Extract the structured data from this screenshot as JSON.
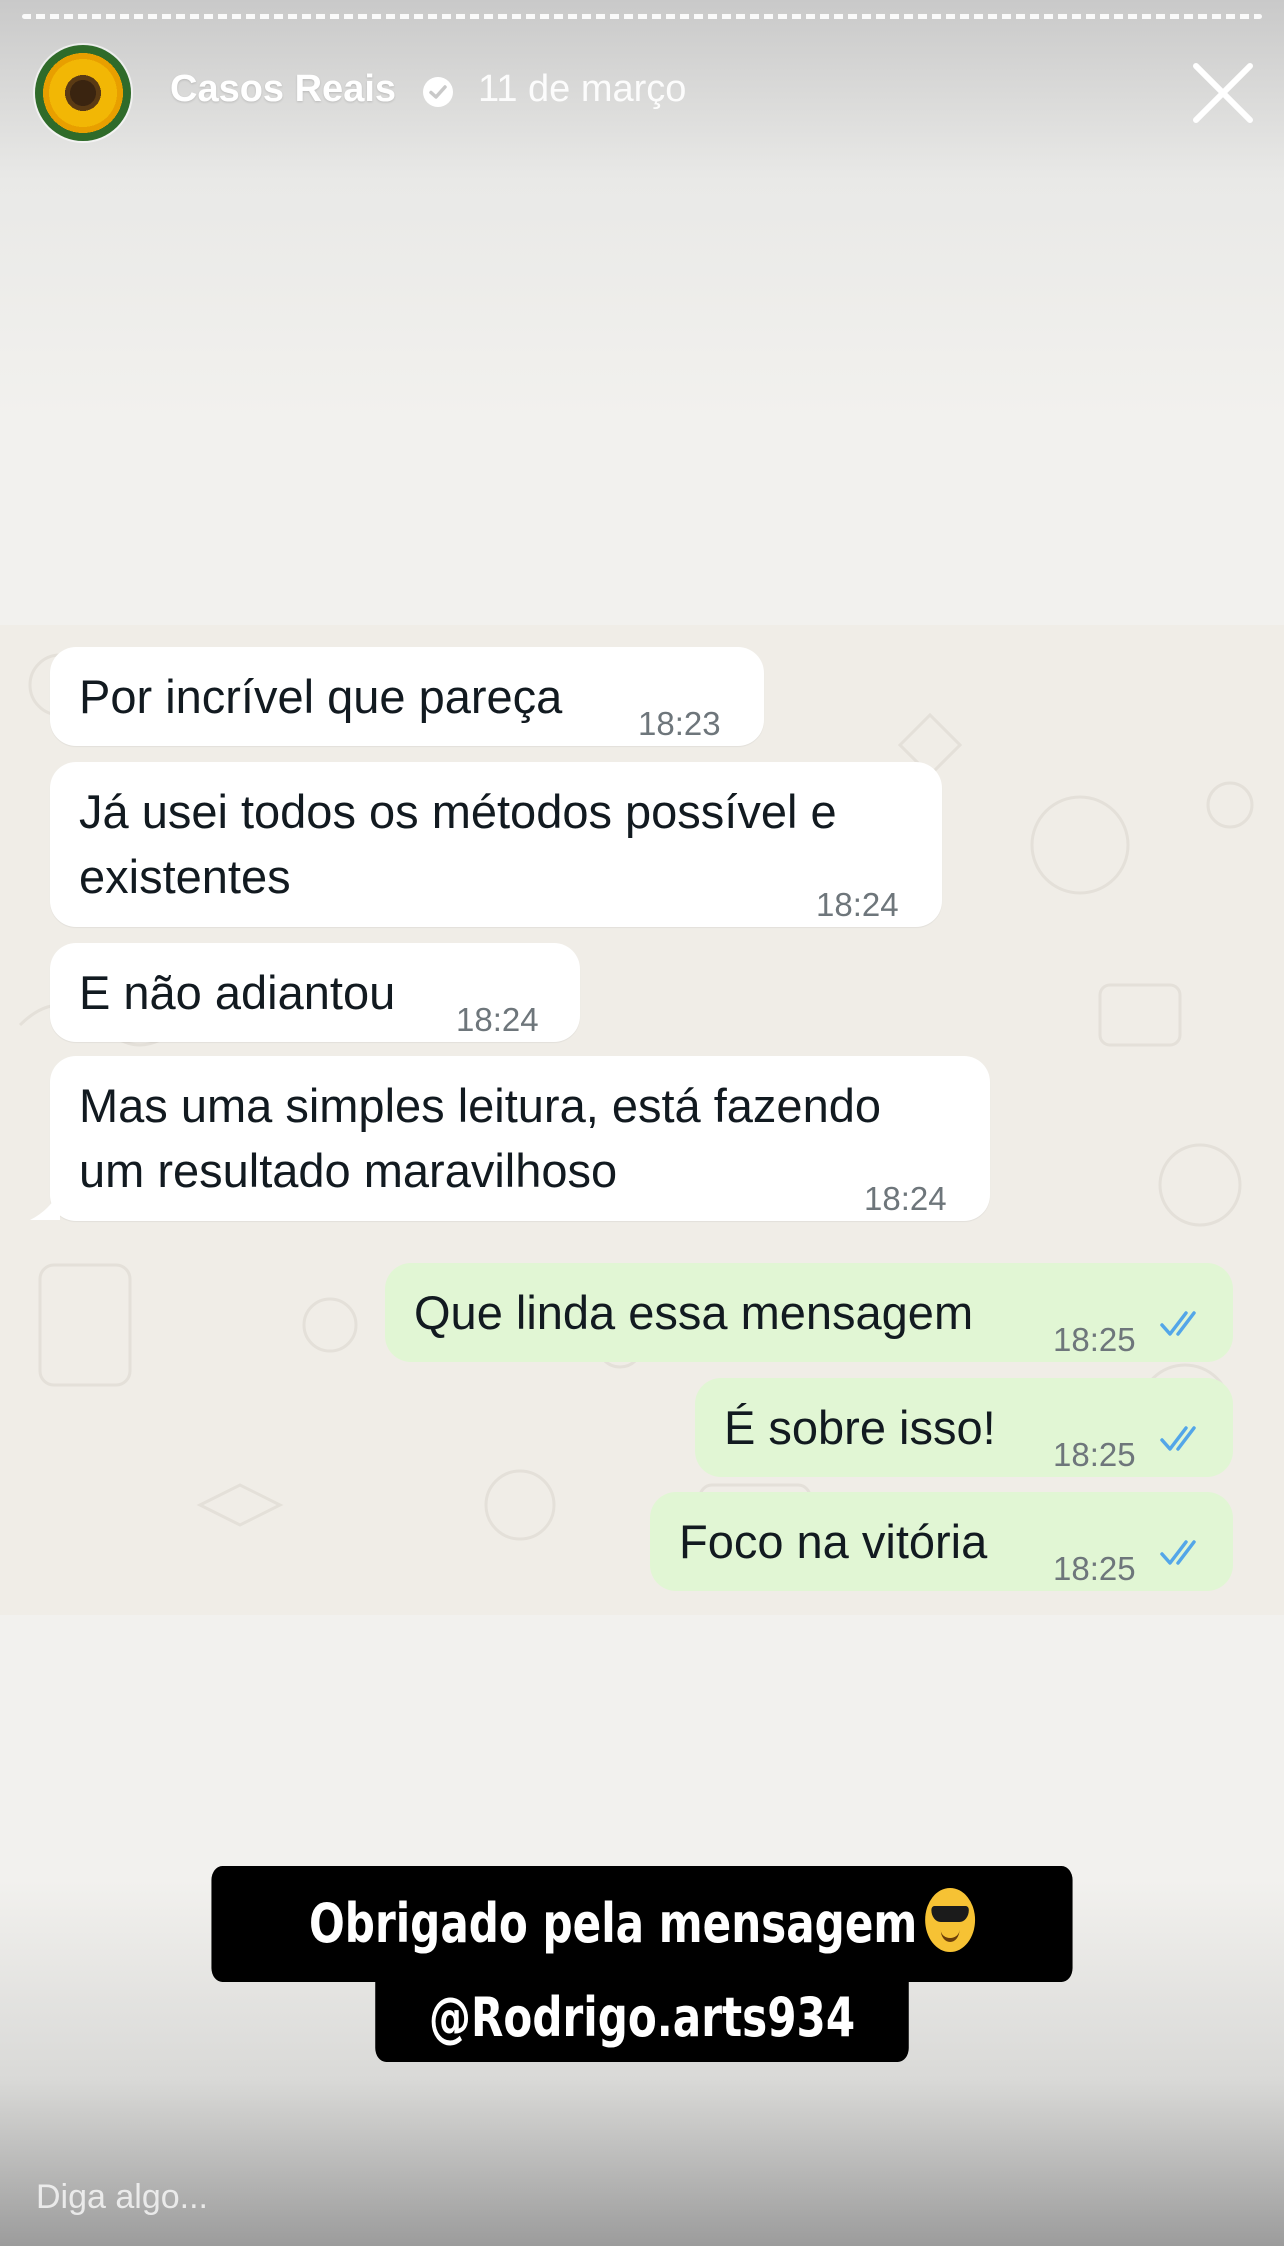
{
  "story": {
    "account_name": "Casos Reais",
    "verified_icon": "verified-badge-icon",
    "date": "11 de março",
    "close_icon": "close-icon"
  },
  "messages": [
    {
      "direction": "in",
      "text": "Por incrível que pareça",
      "time": "18:23"
    },
    {
      "direction": "in",
      "text_lines": [
        "Já usei todos os métodos possível e",
        "existentes"
      ],
      "time": "18:24"
    },
    {
      "direction": "in",
      "text": "E não adiantou",
      "time": "18:24"
    },
    {
      "direction": "in",
      "text_lines": [
        "Mas uma simples leitura, está fazendo",
        "um resultado maravilhoso"
      ],
      "time": "18:24"
    },
    {
      "direction": "out",
      "text": "Que linda essa mensagem",
      "time": "18:25",
      "status": "read"
    },
    {
      "direction": "out",
      "text": "É sobre isso!",
      "time": "18:25",
      "status": "read"
    },
    {
      "direction": "out",
      "text": "Foco na vitória",
      "time": "18:25",
      "status": "read"
    }
  ],
  "caption": {
    "line1": "Obrigado pela mensagem",
    "line1_emoji": "smiling-face-with-sunglasses-emoji",
    "line2": "@Rodrigo.arts934"
  },
  "reply": {
    "placeholder": "Diga algo..."
  },
  "colors": {
    "incoming_bubble": "#ffffff",
    "outgoing_bubble": "#e1f6d4",
    "read_ticks": "#53a6e8",
    "caption_bg": "#000000"
  }
}
